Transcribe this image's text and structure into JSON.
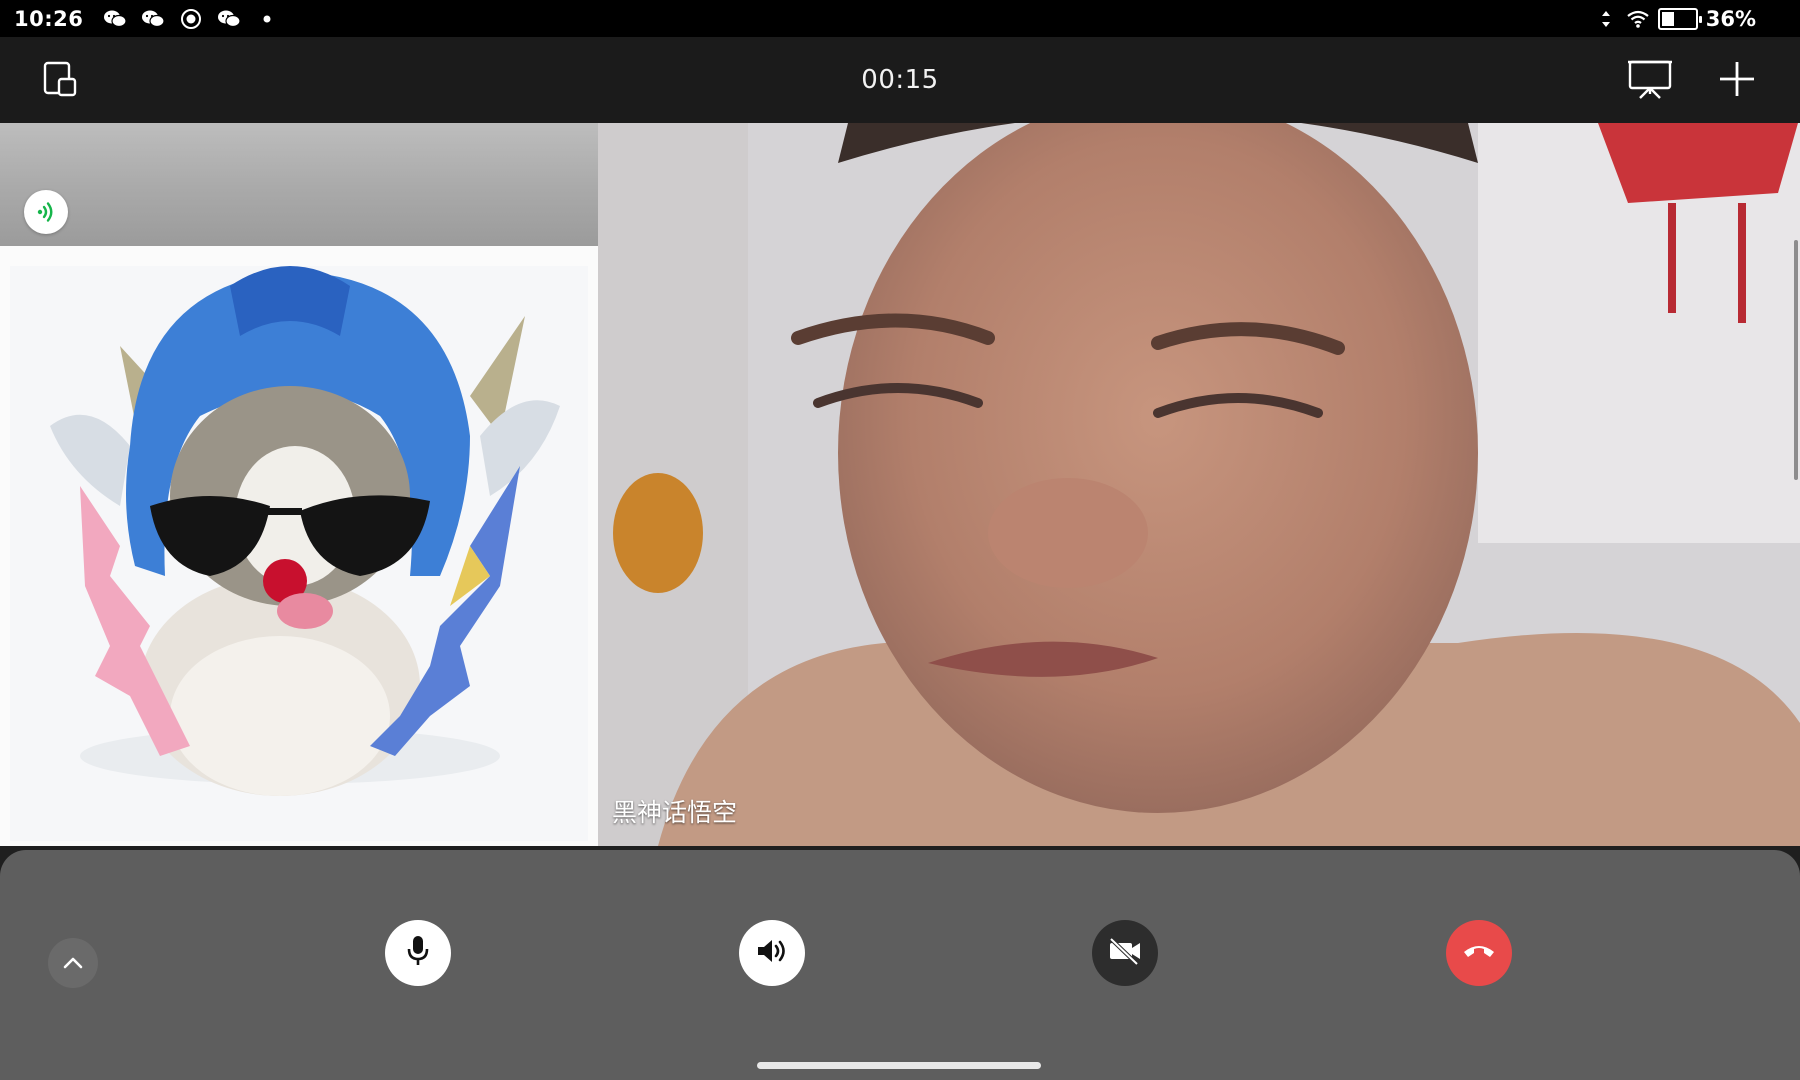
{
  "status_bar": {
    "time": "10:26",
    "notification_icons": [
      "wechat-icon",
      "wechat-icon",
      "record-icon",
      "wechat-icon",
      "dot-icon"
    ],
    "battery_percent": "36%",
    "battery_level": 0.36
  },
  "top_bar": {
    "call_timer": "00:15",
    "left_icon": "minimize-window-icon",
    "right_icons": [
      "screen-share-icon",
      "add-participant-icon"
    ]
  },
  "participants": [
    {
      "role": "self-preview",
      "speaking": true,
      "avatar": "cat-avatar"
    },
    {
      "role": "remote-video",
      "name": "黑神话悟空"
    }
  ],
  "controls": {
    "expand_icon": "chevron-up-icon",
    "buttons": [
      {
        "name": "microphone",
        "icon": "microphone-icon",
        "state": "on",
        "color": "#ffffff"
      },
      {
        "name": "speaker",
        "icon": "speaker-icon",
        "state": "on",
        "color": "#ffffff"
      },
      {
        "name": "camera",
        "icon": "camera-off-icon",
        "state": "off",
        "color": "#2d2d2d"
      },
      {
        "name": "hang-up",
        "icon": "hang-up-icon",
        "color": "#e84a4a"
      }
    ]
  },
  "colors": {
    "accent_green": "#16b54a",
    "hangup_red": "#e84a4a",
    "panel_gray": "#5e5e5e"
  }
}
